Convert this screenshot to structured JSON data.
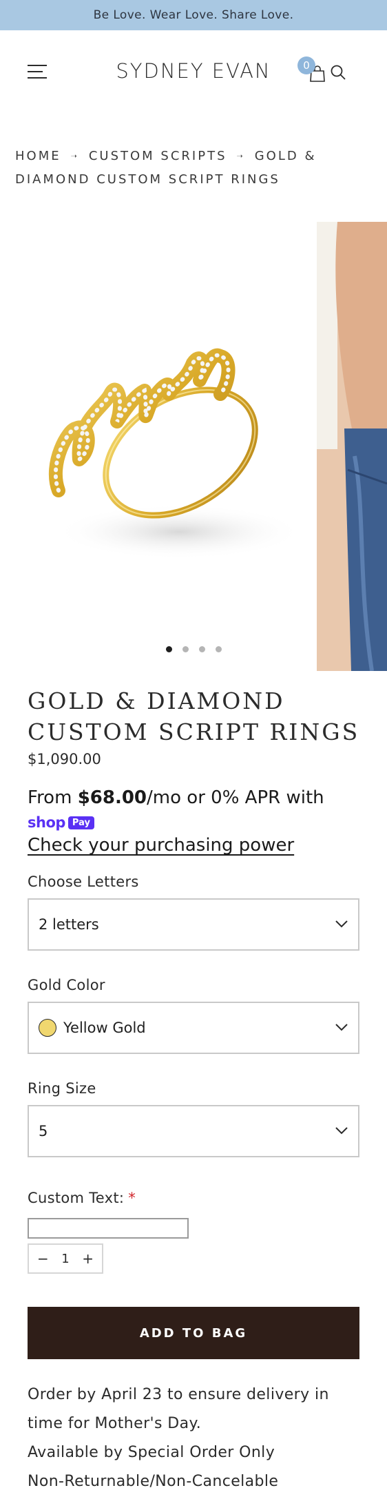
{
  "announcement": "Be Love. Wear Love. Share Love.",
  "header": {
    "logo": "SYDNEY EVAN",
    "cart_count": "0"
  },
  "breadcrumb": {
    "items": [
      "HOME",
      "CUSTOM SCRIPTS",
      "GOLD & DIAMOND CUSTOM SCRIPT RINGS"
    ]
  },
  "gallery": {
    "slide_count": 4,
    "active_index": 0
  },
  "product": {
    "title_line1": "GOLD & DIAMOND",
    "title_line2": "CUSTOM SCRIPT RINGS",
    "price": "$1,090.00"
  },
  "installments": {
    "prefix": "From ",
    "amount": "$68.00",
    "suffix": "/mo or 0% APR with",
    "brand": "shop",
    "brand_badge": "Pay",
    "link": "Check your purchasing power"
  },
  "options": {
    "letters": {
      "label": "Choose Letters",
      "value": "2 letters"
    },
    "gold_color": {
      "label": "Gold Color",
      "value": "Yellow Gold",
      "swatch": "#f0d76f"
    },
    "ring_size": {
      "label": "Ring Size",
      "value": "5"
    },
    "custom_text": {
      "label": "Custom Text:",
      "required_mark": "*",
      "value": ""
    }
  },
  "quantity": {
    "minus": "−",
    "value": "1",
    "plus": "+"
  },
  "add_to_bag": "ADD TO BAG",
  "notes": {
    "line1": "Order by April 23 to ensure delivery in",
    "line2": "time for Mother's Day.",
    "line3": "Available by Special Order Only",
    "line4": "Non-Returnable/Non-Cancelable"
  },
  "colors": {
    "announcement_bg": "#a9c8e2",
    "button_bg": "#2f1e18",
    "shoppay": "#5a31f4",
    "gold": "#d9b23a"
  }
}
